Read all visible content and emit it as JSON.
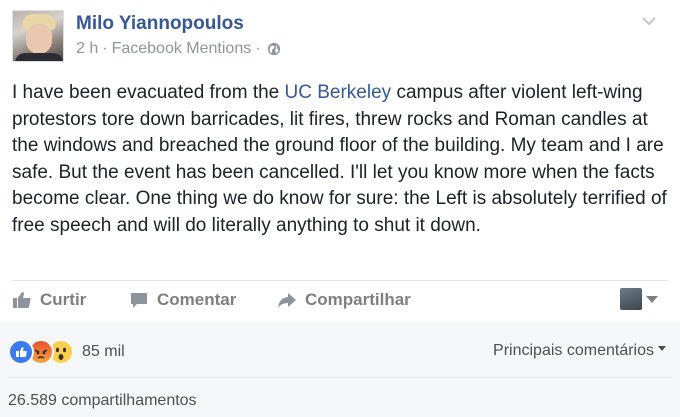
{
  "post": {
    "author": "Milo Yiannopoulos",
    "time": "2 h",
    "separator": "·",
    "source": "Facebook Mentions",
    "separator2": "·",
    "text_before_link": "I have been evacuated from the ",
    "link_text": "UC Berkeley",
    "text_after_link": " campus after violent left-wing protestors tore down barricades, lit fires, threw rocks and Roman candles at the windows and breached the ground floor of the building. My team and I are safe. But the event has been cancelled. I'll let you know more when the facts become clear. One thing we do know for sure: the Left is absolutely terrified of free speech and will do literally anything to shut it down."
  },
  "actions": {
    "like_label": "Curtir",
    "comment_label": "Comentar",
    "share_label": "Compartilhar"
  },
  "footer": {
    "reactions_count": "85 mil",
    "top_comments_label": "Principais comentários",
    "shares_label": "26.589 compartilhamentos"
  },
  "icons": {
    "audience": "globe-icon",
    "menu": "chevron-down-icon",
    "like": "thumbs-up-icon",
    "comment": "speech-bubble-icon",
    "share": "share-arrow-icon",
    "reactions": [
      "like-reaction-icon",
      "angry-reaction-icon",
      "wow-reaction-icon"
    ]
  },
  "colors": {
    "link": "#365899",
    "meta": "#90949c",
    "action": "#7f7f7f",
    "footer_bg": "#f6f7f9"
  }
}
